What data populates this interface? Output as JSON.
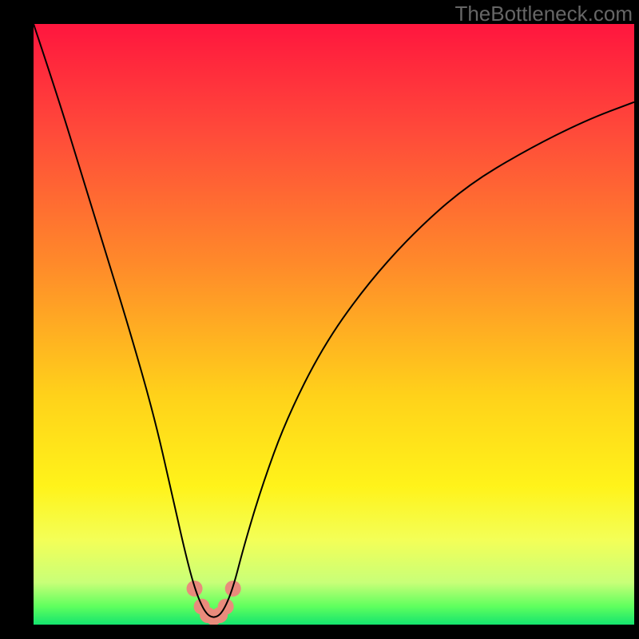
{
  "attribution": "TheBottleneck.com",
  "chart_data": {
    "type": "line",
    "title": "",
    "xlabel": "",
    "ylabel": "",
    "xlim": [
      0,
      100
    ],
    "ylim": [
      0,
      100
    ],
    "background_gradient": {
      "stops": [
        {
          "pos": 0.0,
          "color": "#ff163e"
        },
        {
          "pos": 0.18,
          "color": "#ff4a3a"
        },
        {
          "pos": 0.4,
          "color": "#ff8a2a"
        },
        {
          "pos": 0.62,
          "color": "#ffd21a"
        },
        {
          "pos": 0.77,
          "color": "#fff31a"
        },
        {
          "pos": 0.86,
          "color": "#f3ff58"
        },
        {
          "pos": 0.93,
          "color": "#c8ff78"
        },
        {
          "pos": 0.97,
          "color": "#5eff5e"
        },
        {
          "pos": 1.0,
          "color": "#14e46e"
        }
      ]
    },
    "series": [
      {
        "name": "curve",
        "x": [
          0,
          4,
          8,
          12,
          16,
          20,
          23,
          25,
          26.8,
          28.5,
          30.0,
          31.5,
          33.2,
          35,
          38,
          42,
          48,
          55,
          63,
          72,
          82,
          92,
          100
        ],
        "y": [
          100,
          88,
          75,
          62,
          49,
          35,
          22,
          13,
          6,
          2,
          1,
          2,
          6,
          13,
          23,
          34,
          46,
          56,
          65,
          73,
          79,
          84,
          87
        ],
        "stroke": "#000000",
        "stroke_width": 2
      },
      {
        "name": "trough-markers",
        "type": "scatter",
        "x": [
          26.8,
          28.0,
          29.0,
          30.0,
          31.0,
          32.0,
          33.2
        ],
        "y": [
          6.0,
          3.0,
          1.6,
          1.2,
          1.6,
          3.0,
          6.0
        ],
        "marker_color": "#e98b7c",
        "marker_radius": 10
      }
    ]
  }
}
